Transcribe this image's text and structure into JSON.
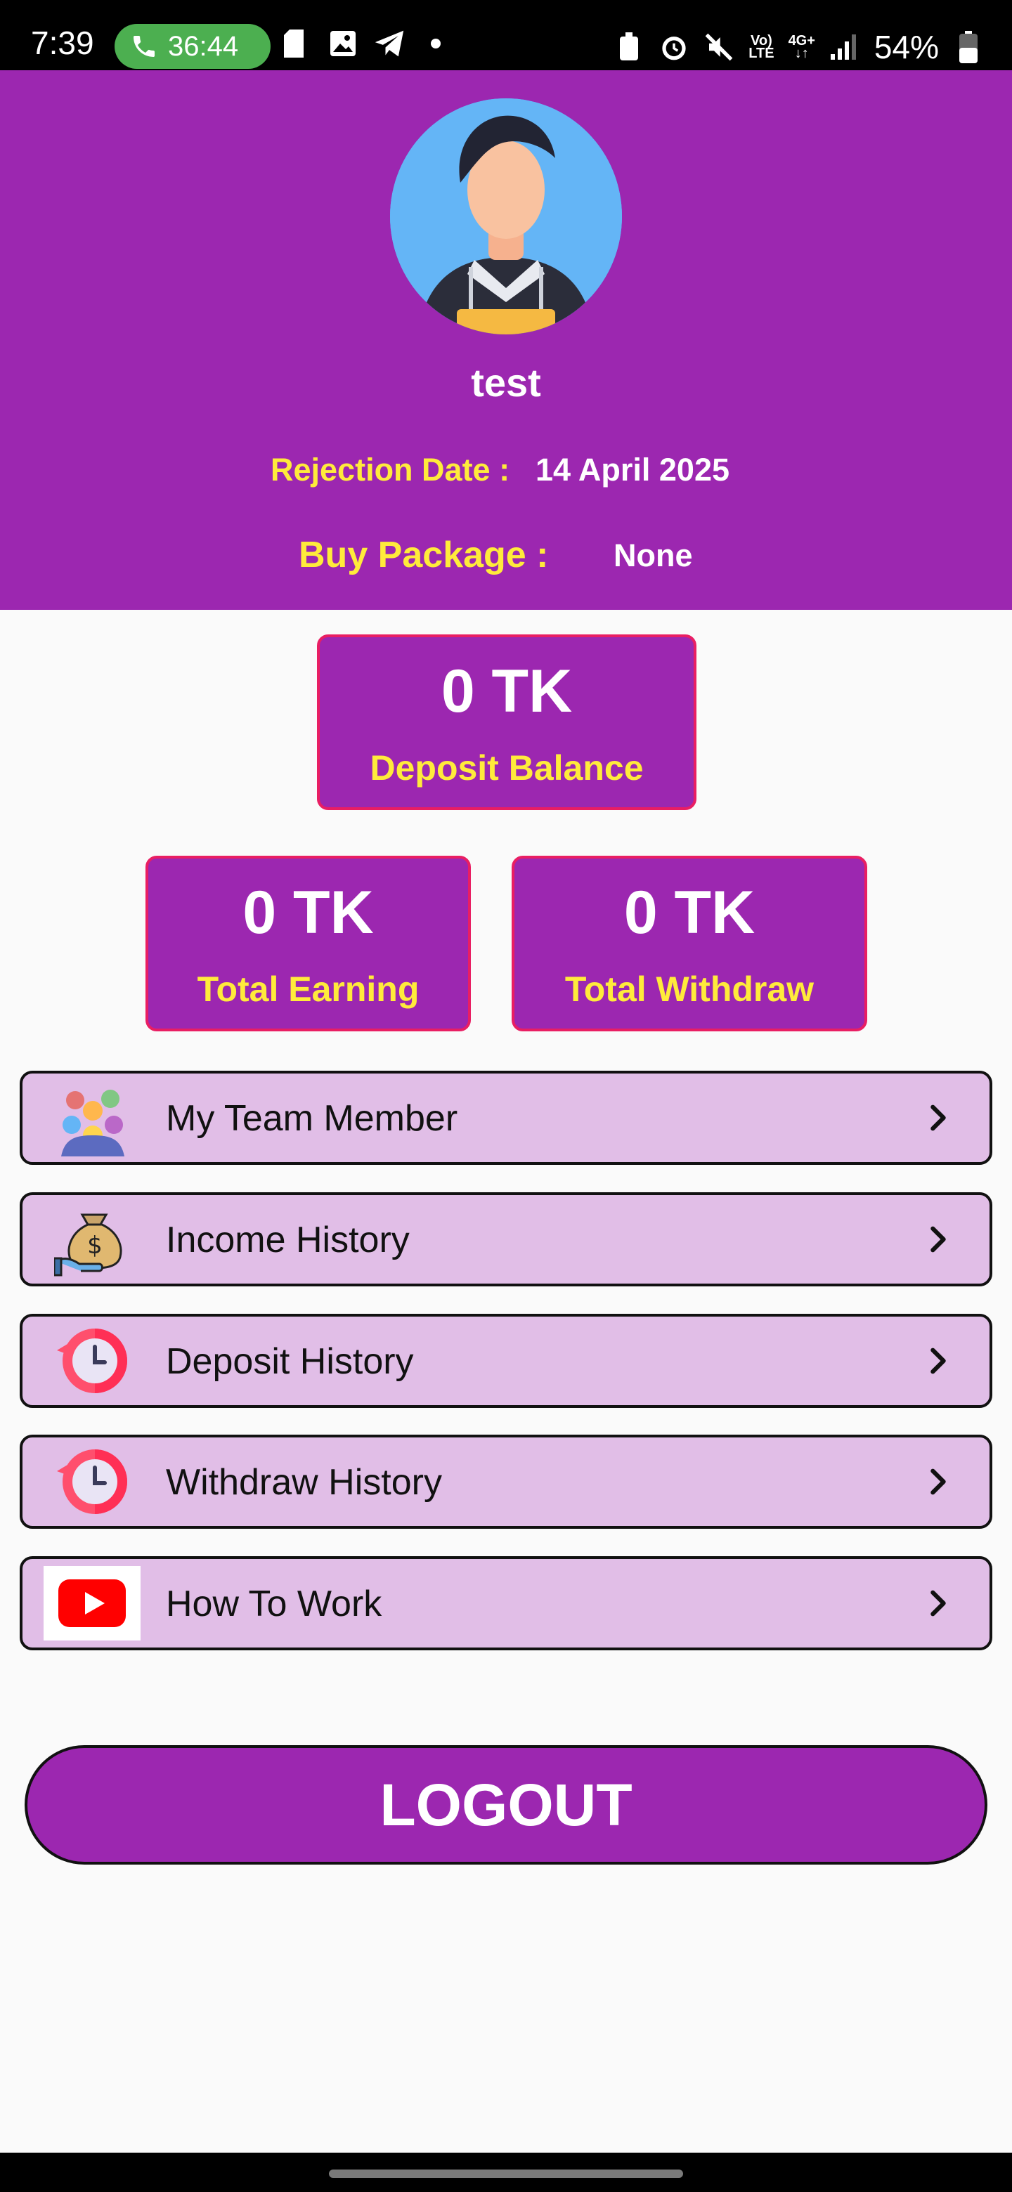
{
  "status_bar": {
    "time": "7:39",
    "call_timer": "36:44",
    "battery": "54%"
  },
  "profile": {
    "username": "test",
    "rejection_label": "Rejection Date :",
    "rejection_date": "14 April 2025",
    "package_label": "Buy Package :",
    "package_value": "None"
  },
  "balances": {
    "deposit": {
      "amount": "0 TK",
      "label": "Deposit Balance"
    },
    "earning": {
      "amount": "0 TK",
      "label": "Total Earning"
    },
    "withdraw": {
      "amount": "0 TK",
      "label": "Total Withdraw"
    }
  },
  "menu": {
    "items": [
      {
        "label": "My Team Member",
        "icon": "team-members-icon"
      },
      {
        "label": "Income History",
        "icon": "money-bag-icon"
      },
      {
        "label": "Deposit History",
        "icon": "history-clock-icon"
      },
      {
        "label": "Withdraw History",
        "icon": "history-clock-icon"
      },
      {
        "label": "How To Work",
        "icon": "youtube-icon"
      }
    ]
  },
  "logout_label": "LOGOUT",
  "colors": {
    "primary": "#9c27b0",
    "accent_text": "#ffeb3b",
    "card_border": "#e91e63",
    "menu_bg": "#e1bee7"
  }
}
